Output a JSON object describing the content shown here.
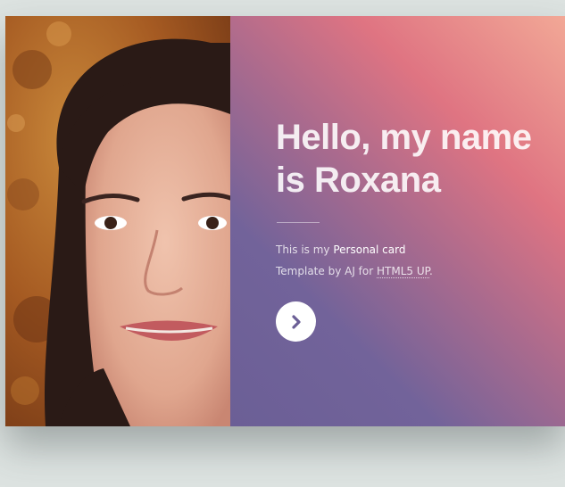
{
  "card": {
    "photo_alt": "Portrait photo",
    "heading_line1": "Hello, my name",
    "heading_line2": "is Roxana",
    "intro_prefix": "This is my ",
    "intro_strong": "Personal card",
    "credit_prefix": "Template by AJ for ",
    "credit_link": "HTML5 UP",
    "credit_suffix": ".",
    "next_icon": "chevron-right-icon"
  },
  "colors": {
    "background": "#dde3e1",
    "gradient_start": "#6b5f96",
    "gradient_mid": "#df7482",
    "gradient_end": "#f2a896",
    "button_fill": "#ffffff",
    "chevron": "#6b5f96"
  }
}
